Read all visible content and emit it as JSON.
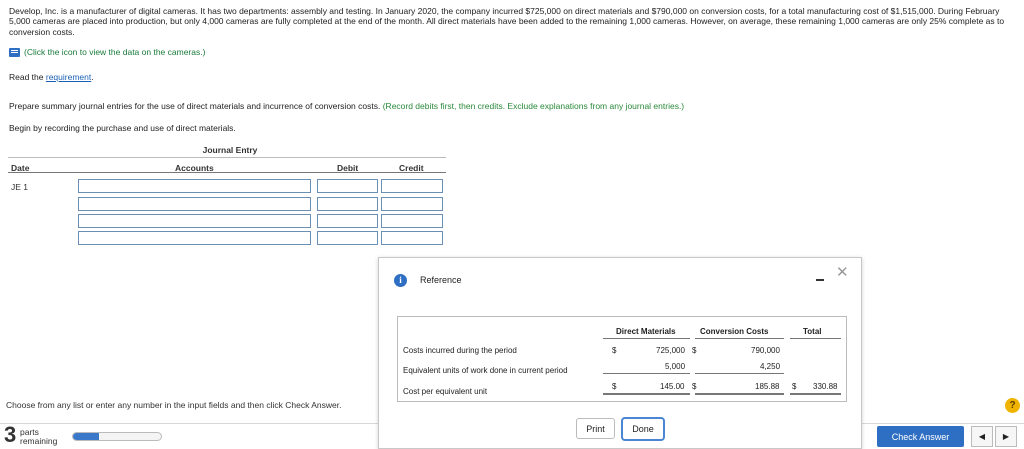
{
  "problem": {
    "text": "Develop, Inc. is a manufacturer of digital cameras. It has two departments: assembly and testing. In January 2020, the company incurred $725,000 on direct materials and $790,000 on conversion costs, for a total manufacturing cost of $1,515,000. During February 5,000 cameras are placed into production, but only 4,000 cameras are fully completed at the end of the month. All direct materials have been added to the remaining 1,000 cameras. However, on average, these remaining 1,000 cameras are only 25% complete as to conversion costs.",
    "data_link": "(Click the icon to view the data on the cameras.)",
    "read_prefix": "Read the ",
    "read_link": "requirement",
    "read_suffix": ".",
    "instruction_main": "Prepare summary journal entries for the use of direct materials and incurrence of conversion costs.",
    "instruction_note": "(Record debits first, then credits. Exclude explanations from any journal entries.)",
    "begin": "Begin by recording the purchase and use of direct materials."
  },
  "journal": {
    "title": "Journal Entry",
    "col_date": "Date",
    "col_accounts": "Accounts",
    "col_debit": "Debit",
    "col_credit": "Credit",
    "entry_label": "JE 1"
  },
  "footer": {
    "choose_text": "Choose from any list or enter any number in the input fields and then click Check Answer.",
    "parts_count": "3",
    "parts_label_1": "parts",
    "parts_label_2": "remaining",
    "progress_fraction": 0.3,
    "check_answer": "Check Answer",
    "prev_glyph": "◀",
    "next_glyph": "▶",
    "help_glyph": "?"
  },
  "dialog": {
    "title": "Reference",
    "info_glyph": "i",
    "close_glyph": "✕",
    "print": "Print",
    "done": "Done",
    "table": {
      "headers": {
        "dm": "Direct Materials",
        "cc": "Conversion Costs",
        "total": "Total"
      },
      "row1": {
        "label": "Costs incurred during the period",
        "dm_sym": "$",
        "dm": "725,000",
        "cc_sym": "$",
        "cc": "790,000"
      },
      "row2": {
        "label": "Equivalent units of work done in current period",
        "dm": "5,000",
        "cc": "4,250"
      },
      "row3": {
        "label": "Cost per equivalent unit",
        "dm_sym": "$",
        "dm": "145.00",
        "cc_sym": "$",
        "cc": "185.88",
        "total_sym": "$",
        "total": "330.88"
      }
    }
  },
  "colors": {
    "accent": "#2f6fc3",
    "green_text": "#2a8a3a",
    "help": "#f0b400"
  }
}
